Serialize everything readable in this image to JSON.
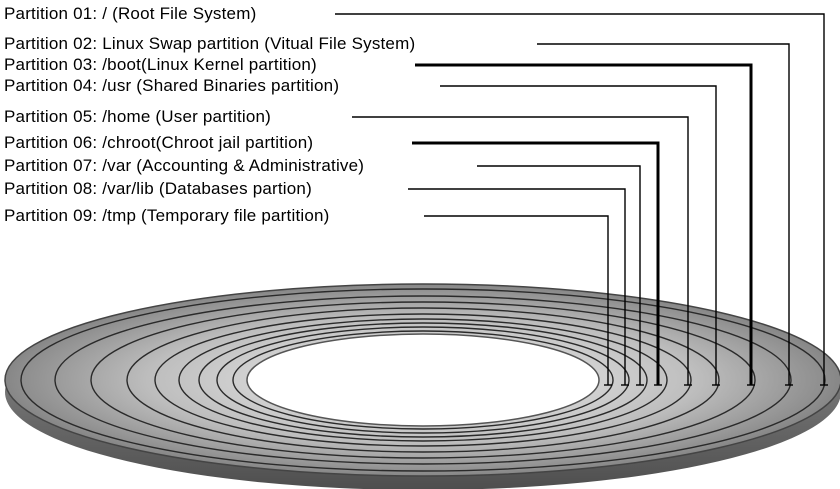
{
  "partitions": [
    {
      "label": "Partition 01: / (Root File System)"
    },
    {
      "label": "Partition 02: Linux Swap partition (Vitual File System)"
    },
    {
      "label": "Partition 03: /boot(Linux Kernel partition)"
    },
    {
      "label": "Partition 04: /usr (Shared Binaries partition)"
    },
    {
      "label": "Partition 05: /home (User partition)"
    },
    {
      "label": "Partition 06: /chroot(Chroot jail partition)"
    },
    {
      "label": "Partition 07: /var (Accounting & Administrative)"
    },
    {
      "label": "Partition 08: /var/lib (Databases partion)"
    },
    {
      "label": "Partition 09: /tmp (Temporary file partition)"
    }
  ],
  "colors": {
    "disk_dark": "#6f6f6f",
    "disk_mid": "#a9a9a9",
    "disk_light": "#d9d9d9",
    "lines": "#000000"
  }
}
